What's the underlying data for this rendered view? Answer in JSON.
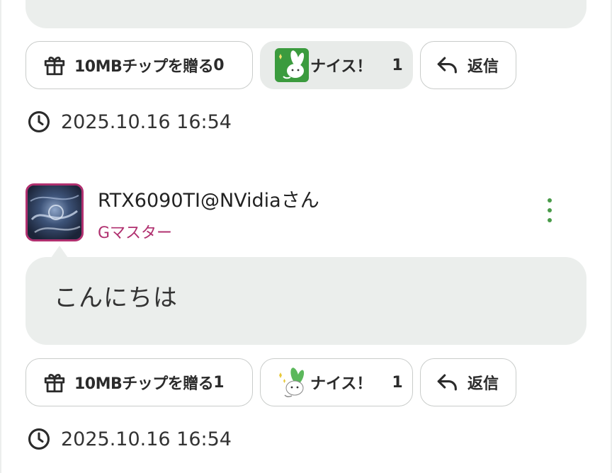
{
  "posts": [
    {
      "actions": {
        "gift_label": "10MBチップを贈る",
        "gift_count": "0",
        "nice_label": "ナイス！",
        "nice_count": "1",
        "nice_active": true,
        "reply_label": "返信"
      },
      "timestamp": "2025.10.16 16:54"
    },
    {
      "author": "RTX6090TI@NVidiaさん",
      "rank": "Gマスター",
      "message": "こんにちは",
      "actions": {
        "gift_label": "10MBチップを贈る",
        "gift_count": "1",
        "nice_label": "ナイス！",
        "nice_count": "1",
        "nice_active": false,
        "reply_label": "返信"
      },
      "timestamp": "2025.10.16 16:54"
    }
  ],
  "colors": {
    "accent_rank": "#b0306f",
    "menu_dots": "#4a9b4a",
    "bubble_bg": "#ebeeec",
    "nice_icon_bg": "#3b9b3e"
  },
  "icons": [
    "gift-icon",
    "nice-rabbit-icon",
    "reply-icon",
    "clock-icon",
    "more-vert-icon"
  ]
}
